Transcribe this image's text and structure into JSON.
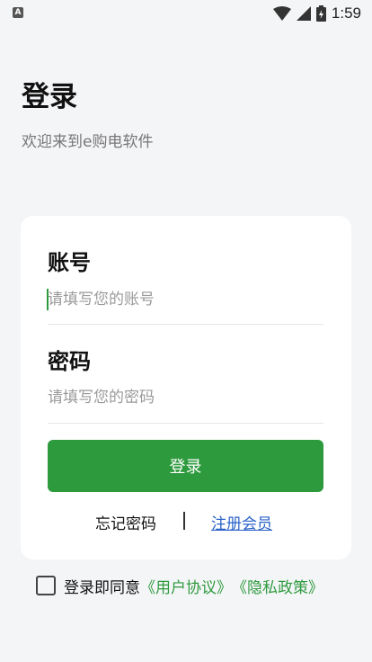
{
  "status_bar": {
    "time": "1:59",
    "app_icon_letter": "A",
    "icons": [
      "wifi-icon",
      "signal-icon",
      "battery-icon"
    ]
  },
  "header": {
    "title": "登录",
    "subtitle": "欢迎来到e购电软件"
  },
  "form": {
    "account_label": "账号",
    "account_placeholder": "请填写您的账号",
    "password_label": "密码",
    "password_placeholder": "请填写您的密码",
    "login_button": "登录",
    "forgot_link": "忘记密码",
    "register_link": "注册会员"
  },
  "agreement": {
    "text": "登录即同意",
    "user_agreement": "《用户协议》",
    "privacy_policy": "《隐私政策》",
    "checked": false
  },
  "colors": {
    "accent": "#2e9a3e",
    "link": "#2a62c9",
    "background": "#f4f5f7"
  }
}
